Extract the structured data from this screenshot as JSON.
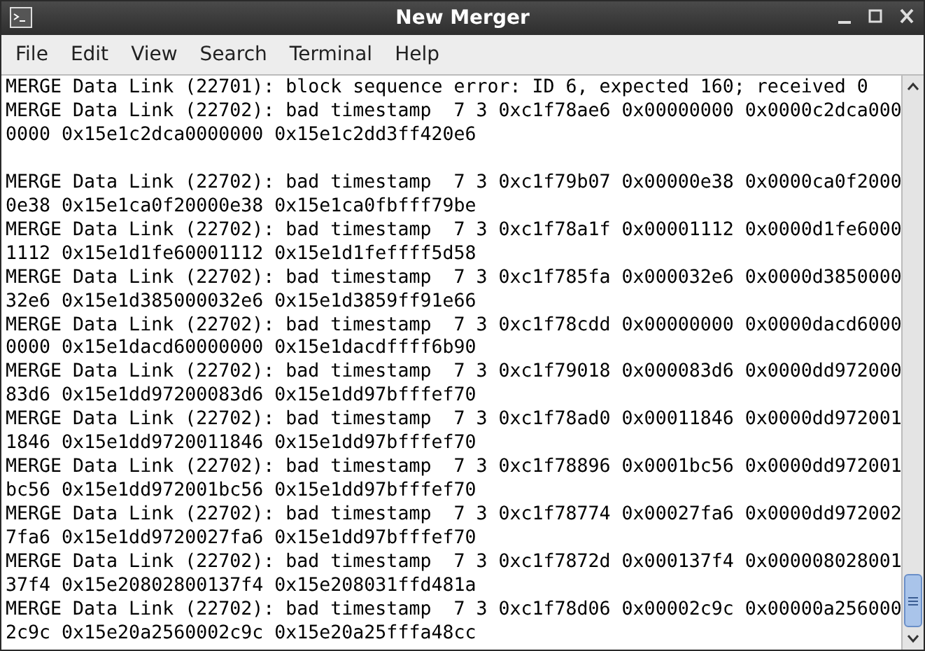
{
  "window": {
    "title": "New Merger"
  },
  "menu": [
    "File",
    "Edit",
    "View",
    "Search",
    "Terminal",
    "Help"
  ],
  "terminal": {
    "lines": [
      {
        "kind": "text",
        "text": "MERGE Data Link (22701): block sequence error: ID 6, expected 160; received 0"
      },
      {
        "kind": "text",
        "text": "MERGE Data Link (22702): bad timestamp  7 3 0xc1f78ae6 0x00000000 0x0000c2dca0000000 0x15e1c2dca0000000 0x15e1c2dd3ff420e6"
      },
      {
        "kind": "blank"
      },
      {
        "kind": "text",
        "text": "MERGE Data Link (22702): bad timestamp  7 3 0xc1f79b07 0x00000e38 0x0000ca0f20000e38 0x15e1ca0f20000e38 0x15e1ca0fbfff79be"
      },
      {
        "kind": "text",
        "text": "MERGE Data Link (22702): bad timestamp  7 3 0xc1f78a1f 0x00001112 0x0000d1fe60001112 0x15e1d1fe60001112 0x15e1d1feffff5d58"
      },
      {
        "kind": "text",
        "text": "MERGE Data Link (22702): bad timestamp  7 3 0xc1f785fa 0x000032e6 0x0000d385000032e6 0x15e1d385000032e6 0x15e1d3859ff91e66"
      },
      {
        "kind": "text",
        "text": "MERGE Data Link (22702): bad timestamp  7 3 0xc1f78cdd 0x00000000 0x0000dacd60000000 0x15e1dacd60000000 0x15e1dacdffff6b90"
      },
      {
        "kind": "text",
        "text": "MERGE Data Link (22702): bad timestamp  7 3 0xc1f79018 0x000083d6 0x0000dd97200083d6 0x15e1dd97200083d6 0x15e1dd97bfffef70"
      },
      {
        "kind": "text",
        "text": "MERGE Data Link (22702): bad timestamp  7 3 0xc1f78ad0 0x00011846 0x0000dd9720011846 0x15e1dd9720011846 0x15e1dd97bfffef70"
      },
      {
        "kind": "text",
        "text": "MERGE Data Link (22702): bad timestamp  7 3 0xc1f78896 0x0001bc56 0x0000dd972001bc56 0x15e1dd972001bc56 0x15e1dd97bfffef70"
      },
      {
        "kind": "text",
        "text": "MERGE Data Link (22702): bad timestamp  7 3 0xc1f78774 0x00027fa6 0x0000dd9720027fa6 0x15e1dd9720027fa6 0x15e1dd97bfffef70"
      },
      {
        "kind": "text",
        "text": "MERGE Data Link (22702): bad timestamp  7 3 0xc1f7872d 0x000137f4 0x00000802800137f4 0x15e20802800137f4 0x15e208031ffd481a"
      },
      {
        "kind": "text",
        "text": "MERGE Data Link (22702): bad timestamp  7 3 0xc1f78d06 0x00002c9c 0x00000a2560002c9c 0x15e20a2560002c9c 0x15e20a25fffa48cc"
      }
    ]
  }
}
